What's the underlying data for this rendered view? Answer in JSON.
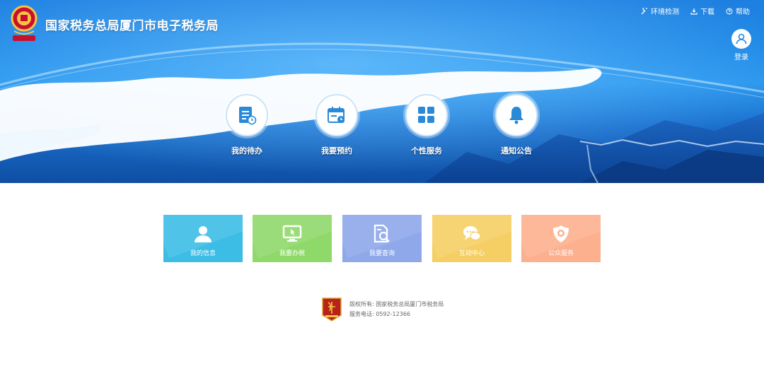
{
  "header": {
    "title": "国家税务总局厦门市电子税务局",
    "emblem_icon": "tax-emblem-icon"
  },
  "top_links": [
    {
      "label": "环境检测",
      "icon": "wrench-icon"
    },
    {
      "label": "下载",
      "icon": "download-icon"
    },
    {
      "label": "帮助",
      "icon": "help-icon"
    }
  ],
  "login": {
    "label": "登录",
    "icon": "user-avatar-icon"
  },
  "hero_nav": [
    {
      "label": "我的待办",
      "icon": "todo-list-icon"
    },
    {
      "label": "我要预约",
      "icon": "calendar-clock-icon"
    },
    {
      "label": "个性服务",
      "icon": "grid-apps-icon"
    },
    {
      "label": "通知公告",
      "icon": "bell-icon"
    }
  ],
  "tiles": [
    {
      "label": "我的信息",
      "icon": "person-icon",
      "color": "#3bbde6"
    },
    {
      "label": "我要办税",
      "icon": "monitor-cursor-icon",
      "color": "#8fd96a"
    },
    {
      "label": "我要查询",
      "icon": "document-search-icon",
      "color": "#8ea8ea"
    },
    {
      "label": "互动中心",
      "icon": "chat-bubbles-icon",
      "color": "#f5cf64"
    },
    {
      "label": "公众服务",
      "icon": "badge-shield-icon",
      "color": "#fdb08e"
    }
  ],
  "footer": {
    "copyright": "版权所有: 国家税务总局厦门市税务局",
    "phone": "服务电话: 0592-12366",
    "badge_icon": "party-badge-icon"
  },
  "colors": {
    "hero_blue": "#1f88e6",
    "icon_blue": "#2a8ad8"
  }
}
